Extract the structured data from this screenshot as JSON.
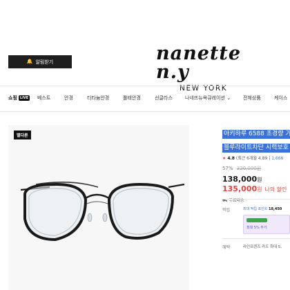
{
  "header": {
    "notify_label": "알림받기",
    "notify_icon": "bell-icon",
    "logo_script": "nanette n.y",
    "logo_city": "NEW YORK"
  },
  "nav": {
    "items": [
      {
        "label": "쇼핑",
        "badge": "LIVE"
      },
      {
        "label": "베스트"
      },
      {
        "label": "안경"
      },
      {
        "label": "티타늄안경"
      },
      {
        "label": "뿔테안경"
      },
      {
        "label": "선글라스"
      },
      {
        "label": "나네뜨뉴욕큐레이션",
        "icon": "chevron-down-icon"
      },
      {
        "label": "전체상품"
      },
      {
        "label": "케이스"
      }
    ]
  },
  "product": {
    "image_tag": "별다른",
    "title_line1": "아키하루 6588 초경량 가",
    "title_line2": "블루라이트차단 시력보호",
    "rating_score": "4.8",
    "rating_detail": "(최근 6개월 4.89",
    "rating_count": "1,666",
    "discount_percent": "57%",
    "original_price": "320,000원",
    "sale_price": "138,000",
    "sale_currency": "원",
    "member_price": "135,000",
    "member_currency": "원",
    "member_note": "나의 할인",
    "shipping": "무료배송",
    "points_label": "적립",
    "points_text": "최대 적립 포인트",
    "points_value": "18,450",
    "points_sub": "최대 5% 추가",
    "benefit_label": "혜택",
    "benefit_text": "라인프렌즈 카드 최대 5,"
  },
  "colors": {
    "accent_blue": "#3a72d9",
    "sale_red": "#e8413b",
    "points_bg": "#efe9fb"
  }
}
